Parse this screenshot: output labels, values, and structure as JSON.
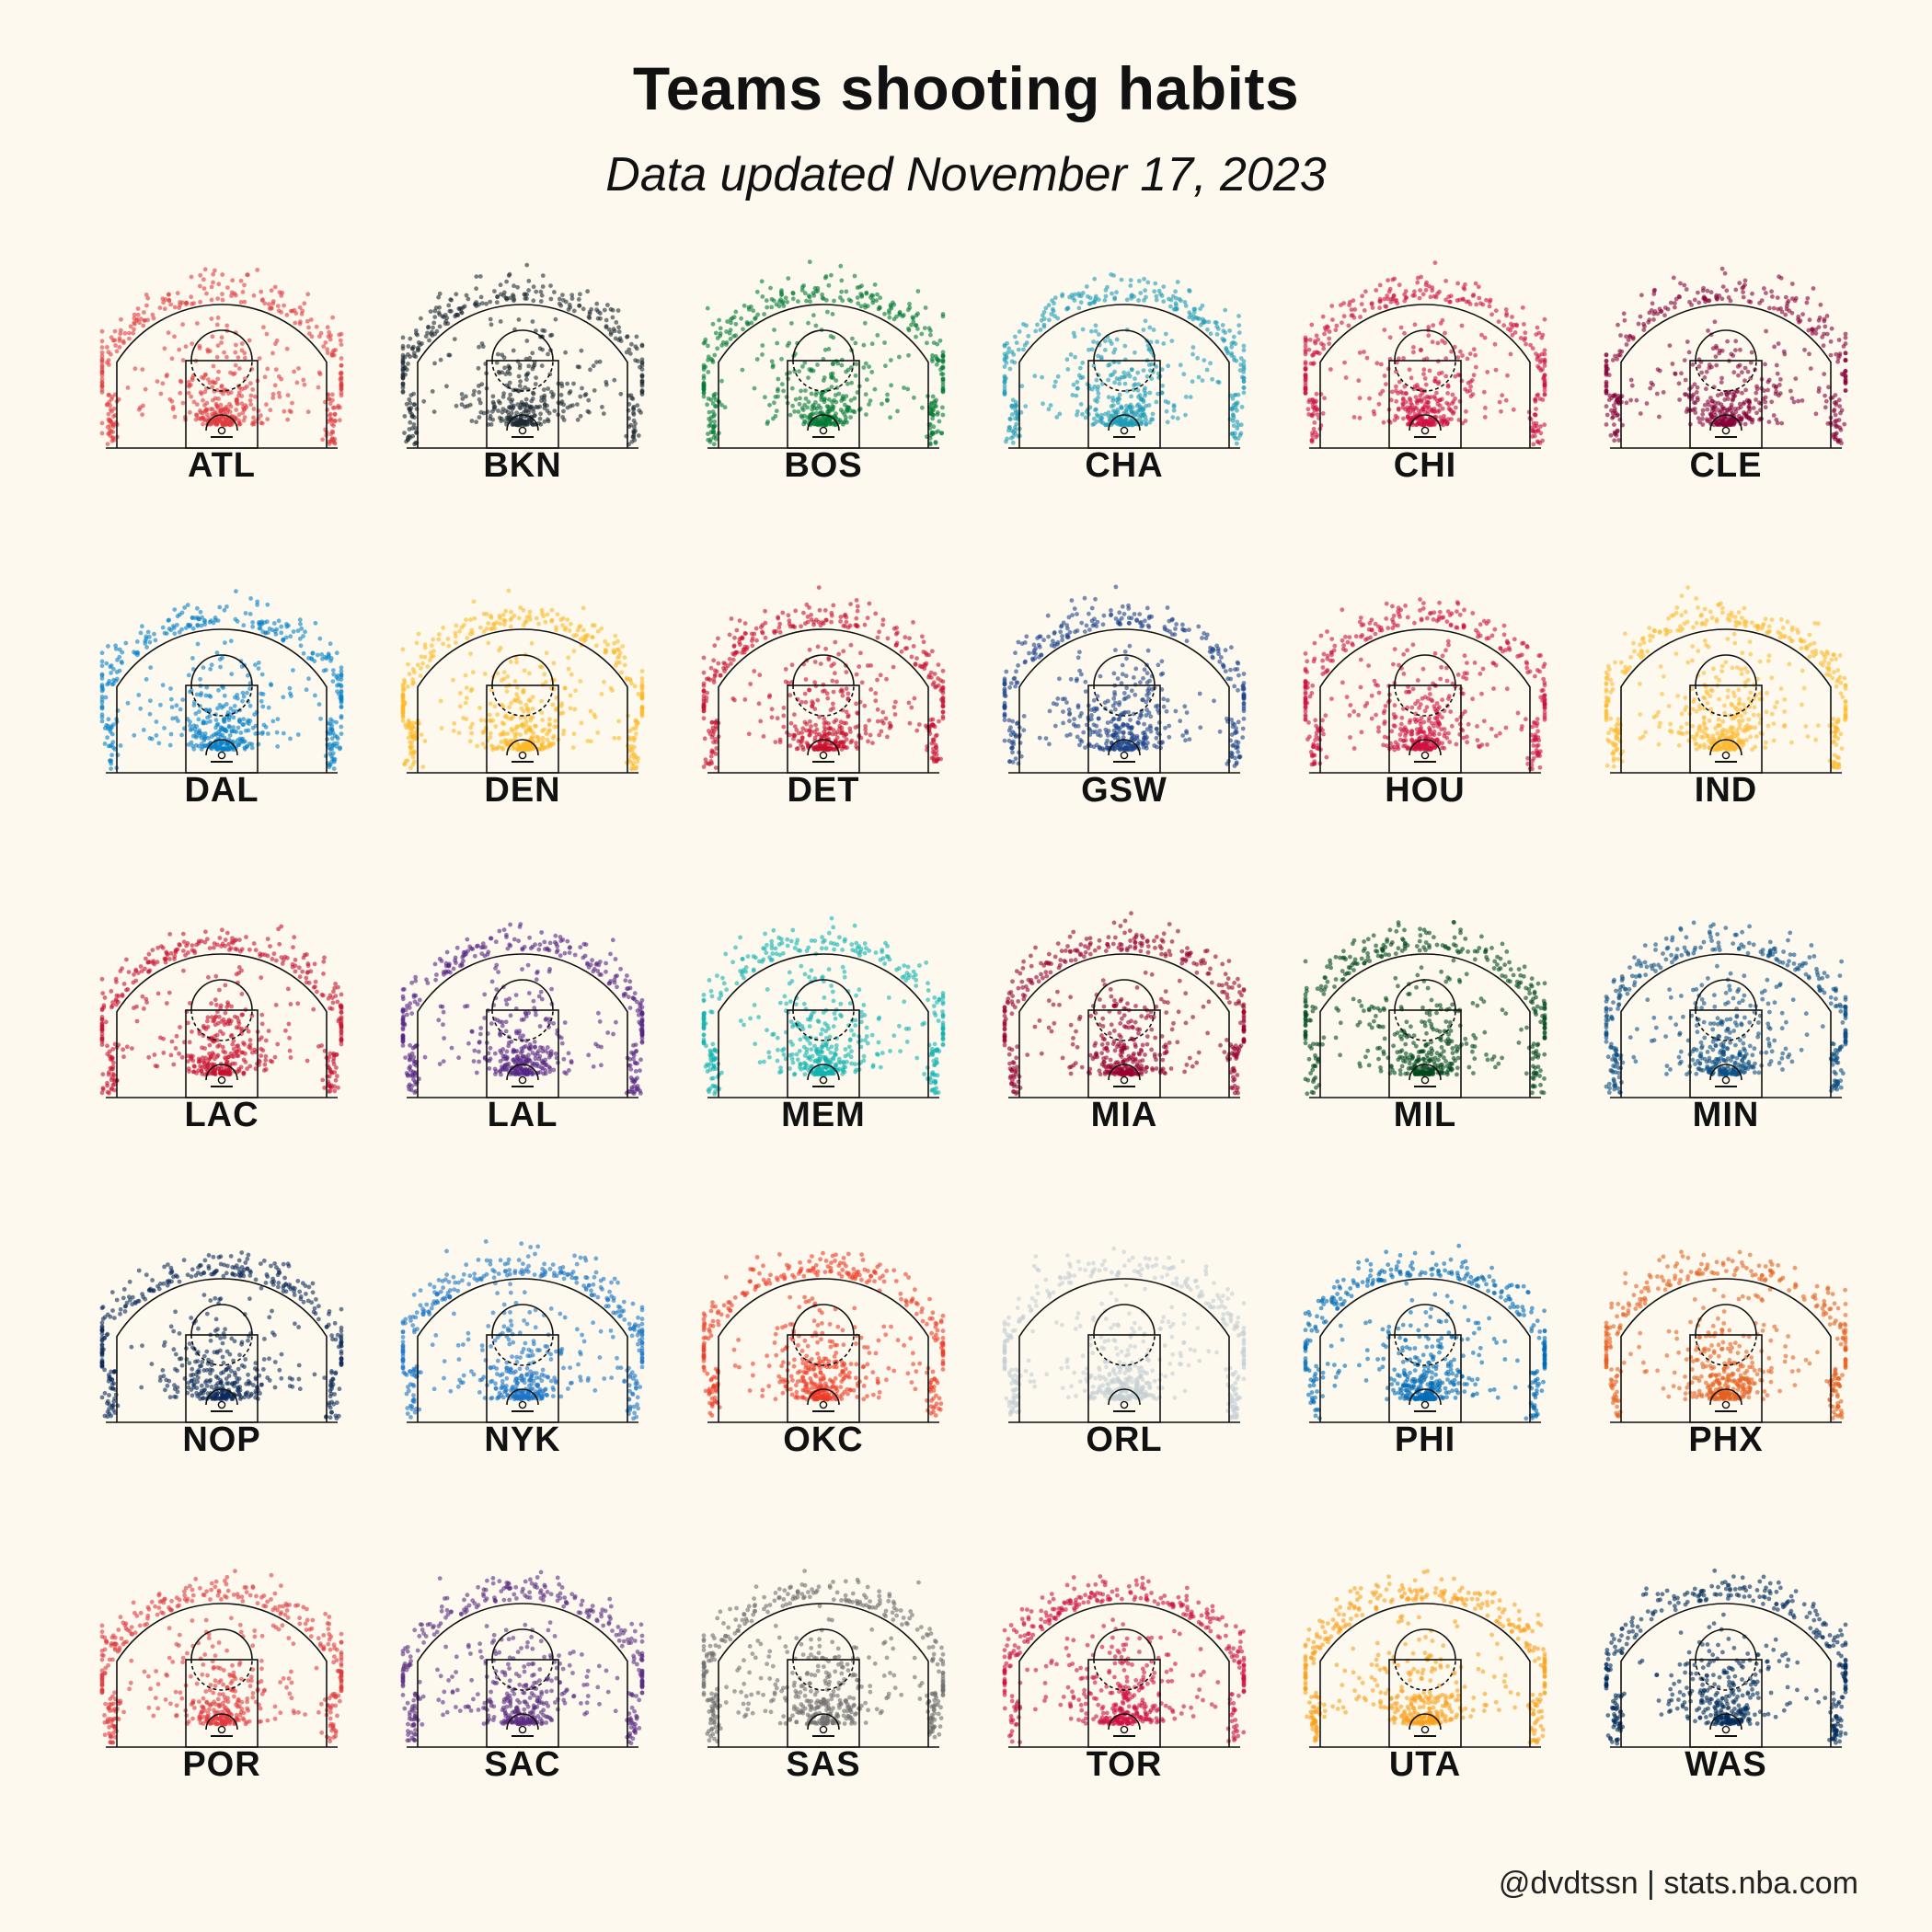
{
  "header": {
    "title": "Teams shooting habits",
    "subtitle": "Data updated November 17, 2023"
  },
  "footer": {
    "credit": "@dvdtssn | stats.nba.com"
  },
  "chart_data": {
    "type": "scatter",
    "title": "Teams shooting habits",
    "subtitle": "Data updated November 17, 2023",
    "panel_layout": {
      "columns": 6,
      "rows": 5
    },
    "teams": [
      {
        "name": "ATL",
        "color": "#e03a3e"
      },
      {
        "name": "BKN",
        "color": "#1d2a33"
      },
      {
        "name": "BOS",
        "color": "#007a33"
      },
      {
        "name": "CHA",
        "color": "#1d9bb5"
      },
      {
        "name": "CHI",
        "color": "#ce1141"
      },
      {
        "name": "CLE",
        "color": "#860038"
      },
      {
        "name": "DAL",
        "color": "#0780c8"
      },
      {
        "name": "DEN",
        "color": "#fdb927"
      },
      {
        "name": "DET",
        "color": "#c8102e"
      },
      {
        "name": "GSW",
        "color": "#1d428a"
      },
      {
        "name": "HOU",
        "color": "#ce1141"
      },
      {
        "name": "IND",
        "color": "#fdbb30"
      },
      {
        "name": "LAC",
        "color": "#c8102e"
      },
      {
        "name": "LAL",
        "color": "#552583"
      },
      {
        "name": "MEM",
        "color": "#12b2b0"
      },
      {
        "name": "MIA",
        "color": "#98002e"
      },
      {
        "name": "MIL",
        "color": "#00471b"
      },
      {
        "name": "MIN",
        "color": "#0c4f83"
      },
      {
        "name": "NOP",
        "color": "#0c2a5a"
      },
      {
        "name": "NYK",
        "color": "#1b75c4"
      },
      {
        "name": "OKC",
        "color": "#ef3b24"
      },
      {
        "name": "ORL",
        "color": "#c4ced4"
      },
      {
        "name": "PHI",
        "color": "#006bb6"
      },
      {
        "name": "PHX",
        "color": "#e56020"
      },
      {
        "name": "POR",
        "color": "#e03a3e"
      },
      {
        "name": "SAC",
        "color": "#5a2d81"
      },
      {
        "name": "SAS",
        "color": "#6e6e6e"
      },
      {
        "name": "TOR",
        "color": "#ce1141"
      },
      {
        "name": "UTA",
        "color": "#f9a01b"
      },
      {
        "name": "WAS",
        "color": "#002b5c"
      }
    ]
  }
}
